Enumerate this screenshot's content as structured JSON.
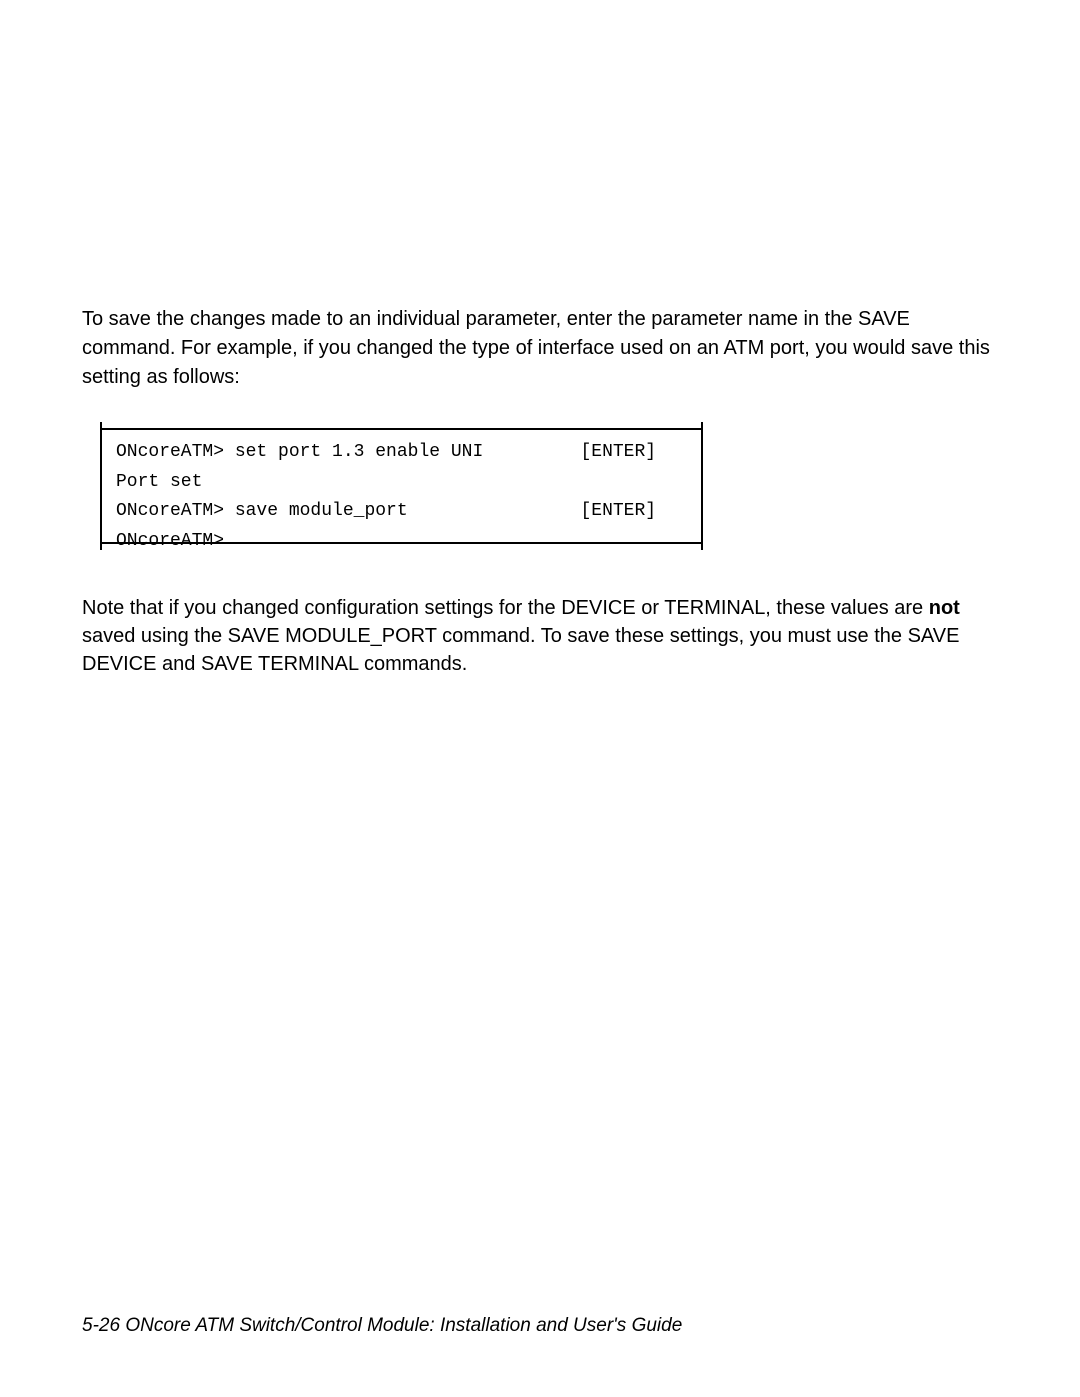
{
  "para1": "To save the changes made to an individual parameter, enter the parameter name in the SAVE command.  For example, if you changed the type of interface used on an ATM port, you would save this setting as follows:",
  "terminal": {
    "line1": "ONcoreATM> set port 1.3 enable UNI         [ENTER]",
    "line2": "Port set",
    "line3": "ONcoreATM> save module_port                [ENTER]",
    "line4": "ONcoreATM>"
  },
  "para2_pre": "Note that if you changed configuration settings for the DEVICE or TERMINAL, these values are ",
  "para2_bold": "not",
  "para2_post": " saved using the SAVE MODULE_PORT command.  To save these settings, you must use the SAVE DEVICE and SAVE TERMINAL commands.",
  "footer": {
    "pagenum": "5-26",
    "title": "ONcore ATM Switch/Control Module:   Installation and User's Guide"
  }
}
